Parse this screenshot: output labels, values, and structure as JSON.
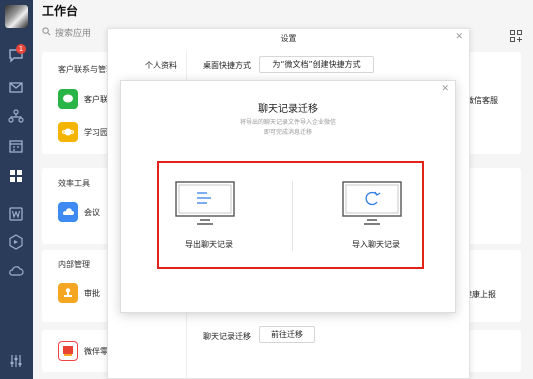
{
  "app": {
    "title": "工作台"
  },
  "sidebar": {
    "badge": "1",
    "items": [
      "message-icon",
      "mail-icon",
      "org-icon",
      "calendar-icon",
      "workbench-icon",
      "doc-icon",
      "cube-icon",
      "cloud-icon",
      "settings-icon"
    ]
  },
  "search": {
    "placeholder": "搜索应用"
  },
  "sections": [
    {
      "title": "客户联系与管理",
      "apps": [
        {
          "label": "客户联系"
        },
        {
          "label": "学习园地"
        }
      ]
    },
    {
      "title": "效率工具",
      "apps": [
        {
          "label": "会议"
        }
      ]
    },
    {
      "title": "内部管理",
      "apps": [
        {
          "label": "审批"
        }
      ]
    },
    {
      "title": "",
      "apps": [
        {
          "label": "微伴零"
        }
      ]
    }
  ],
  "right_items": {
    "wechat_service": "微信客服",
    "health_report": "健康上报"
  },
  "settings": {
    "title": "设置",
    "tab": "个人资料",
    "desktop_shortcut_label": "桌面快捷方式",
    "desktop_shortcut_button": "为“微文档”创建快捷方式",
    "migration_label": "聊天记录迁移",
    "migration_button": "前往迁移"
  },
  "migration": {
    "title": "聊天记录迁移",
    "desc_line1": "将导出的聊天记录文件导入企业微信",
    "desc_line2": "即可完成消息迁移",
    "export_label": "导出聊天记录",
    "import_label": "导入聊天记录"
  },
  "colors": {
    "accent": "#2e7ce6",
    "highlight": "#e2231a",
    "sidebar": "#2b3b5a"
  }
}
